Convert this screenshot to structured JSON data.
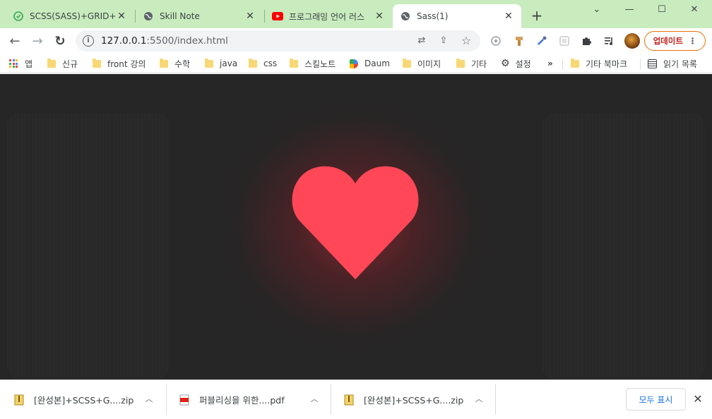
{
  "tabs": [
    {
      "title": "SCSS(SASS)+GRID+FL",
      "close": "✕"
    },
    {
      "title": "Skill Note",
      "close": "✕"
    },
    {
      "title": "프로그래밍 언어 러스",
      "close": "✕"
    },
    {
      "title": "Sass(1)",
      "close": "✕"
    }
  ],
  "new_tab": "+",
  "window": {
    "minimize": "—",
    "maximize": "☐",
    "close": "✕",
    "tabsearch": "⌄"
  },
  "nav": {
    "back": "←",
    "forward": "→",
    "reload": "↻"
  },
  "address": {
    "host": "127.0.0.1",
    "path": ":5500/index.html",
    "info": "i"
  },
  "omnibox_icons": {
    "translate": "⇄",
    "share": "⇪",
    "star": "☆"
  },
  "toolbar": {
    "update_label": "업데이트",
    "menu": "⋮"
  },
  "bookmarks": [
    {
      "label": "앱"
    },
    {
      "label": "신규"
    },
    {
      "label": "front 강의"
    },
    {
      "label": "수학"
    },
    {
      "label": "java"
    },
    {
      "label": "css"
    },
    {
      "label": "스킬노트"
    },
    {
      "label": "Daum"
    },
    {
      "label": "이미지"
    },
    {
      "label": "기타"
    },
    {
      "label": "설정"
    },
    {
      "label": "»"
    },
    {
      "label": "기타 북마크"
    },
    {
      "label": "읽기 목록"
    }
  ],
  "colors": {
    "heart": "#ff4757",
    "tabstrip": "#c9ecbf",
    "content_bg": "#262626",
    "update_border": "#e8710a"
  },
  "downloads": [
    {
      "name": "[완성본]+SCSS+G....zip",
      "caret": "︿"
    },
    {
      "name": "퍼블리싱을 위한....pdf",
      "caret": "︿"
    },
    {
      "name": "[완성본]+SCSS+G....zip",
      "caret": "︿"
    }
  ],
  "shelf": {
    "show_all": "모두 표시",
    "close": "✕"
  }
}
